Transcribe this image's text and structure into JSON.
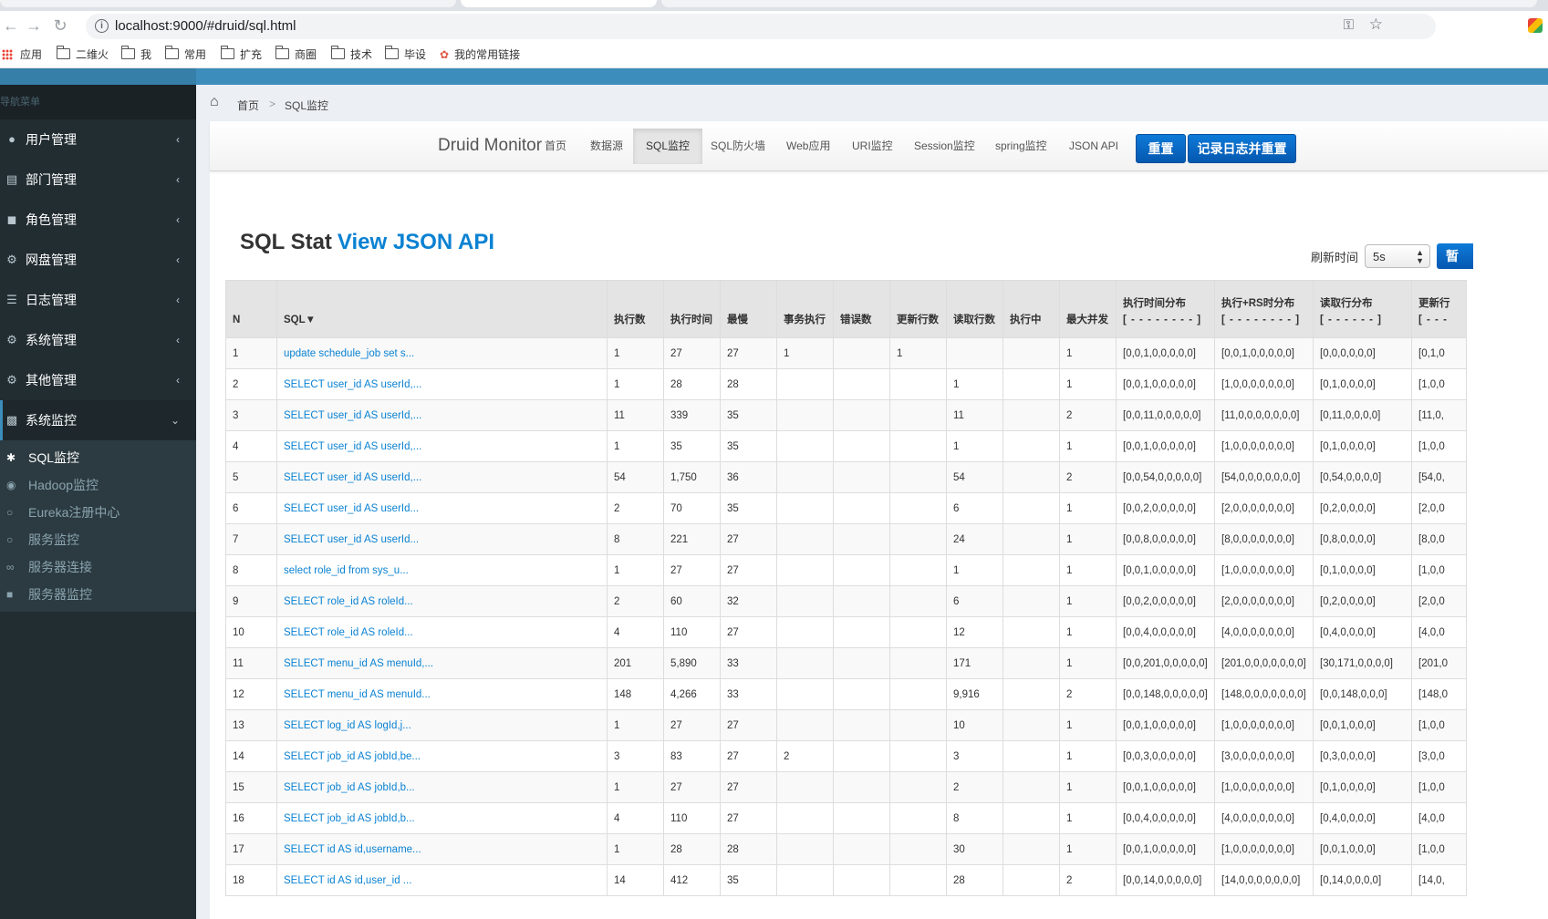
{
  "browser": {
    "url": "localhost:9000/#druid/sql.html",
    "bookmarks": [
      "应用",
      "二维火",
      "我",
      "常用",
      "扩充",
      "商圈",
      "技术",
      "毕设",
      "我的常用链接"
    ]
  },
  "sidebar": {
    "header": "导航菜单",
    "items": [
      {
        "label": "用户管理",
        "icon": "user-icon"
      },
      {
        "label": "部门管理",
        "icon": "id-card-icon"
      },
      {
        "label": "角色管理",
        "icon": "lock-icon"
      },
      {
        "label": "网盘管理",
        "icon": "gear-icon"
      },
      {
        "label": "日志管理",
        "icon": "file-icon"
      },
      {
        "label": "系统管理",
        "icon": "gear-icon"
      },
      {
        "label": "其他管理",
        "icon": "gear-icon"
      },
      {
        "label": "系统监控",
        "icon": "bar-chart-icon"
      }
    ],
    "subitems": [
      {
        "label": "SQL监控",
        "icon": "bug-icon"
      },
      {
        "label": "Hadoop监控",
        "icon": "eye-icon"
      },
      {
        "label": "Eureka注册中心",
        "icon": "circle-icon"
      },
      {
        "label": "服务监控",
        "icon": "circle-icon"
      },
      {
        "label": "服务器连接",
        "icon": "link-icon"
      },
      {
        "label": "服务器监控",
        "icon": "video-icon"
      }
    ]
  },
  "breadcrumb": {
    "home": "首页",
    "current": "SQL监控"
  },
  "druid_nav": {
    "brand": "Druid Monitor",
    "items": [
      "首页",
      "数据源",
      "SQL监控",
      "SQL防火墙",
      "Web应用",
      "URI监控",
      "Session监控",
      "spring监控",
      "JSON API"
    ],
    "active": "SQL监控",
    "reset_button": "重置",
    "log_reset_button": "记录日志并重置"
  },
  "page": {
    "title": "SQL Stat",
    "json_link": "View JSON API",
    "refresh_label": "刷新时间",
    "refresh_value": "5s",
    "pause_button": "暂"
  },
  "table": {
    "headers": [
      {
        "l1": "N"
      },
      {
        "l1": "SQL▼"
      },
      {
        "l1": "执行数"
      },
      {
        "l1": "执行时间"
      },
      {
        "l1": "最慢"
      },
      {
        "l1": "事务执行"
      },
      {
        "l1": "错误数"
      },
      {
        "l1": "更新行数"
      },
      {
        "l1": "读取行数"
      },
      {
        "l1": "执行中"
      },
      {
        "l1": "最大并发"
      },
      {
        "l1": "执行时间分布",
        "l2": "[ - - - - - - - - ]"
      },
      {
        "l1": "执行+RS时分布",
        "l2": "[ - - - - - - - - ]"
      },
      {
        "l1": "读取行分布",
        "l2": "[ - - - - - - ]"
      },
      {
        "l1": "更新行",
        "l2": "[ - - -"
      }
    ],
    "rows": [
      [
        "1",
        "update schedule_job set s...",
        "1",
        "27",
        "27",
        "1",
        "",
        "1",
        "",
        "",
        "1",
        "[0,0,1,0,0,0,0,0]",
        "[0,0,1,0,0,0,0,0]",
        "[0,0,0,0,0,0]",
        "[0,1,0"
      ],
      [
        "2",
        "SELECT user_id AS userId,...",
        "1",
        "28",
        "28",
        "",
        "",
        "",
        "1",
        "",
        "1",
        "[0,0,1,0,0,0,0,0]",
        "[1,0,0,0,0,0,0,0]",
        "[0,1,0,0,0,0]",
        "[1,0,0"
      ],
      [
        "3",
        "SELECT user_id AS userId,...",
        "11",
        "339",
        "35",
        "",
        "",
        "",
        "11",
        "",
        "2",
        "[0,0,11,0,0,0,0,0]",
        "[11,0,0,0,0,0,0,0]",
        "[0,11,0,0,0,0]",
        "[11,0,"
      ],
      [
        "4",
        "SELECT user_id AS userId,...",
        "1",
        "35",
        "35",
        "",
        "",
        "",
        "1",
        "",
        "1",
        "[0,0,1,0,0,0,0,0]",
        "[1,0,0,0,0,0,0,0]",
        "[0,1,0,0,0,0]",
        "[1,0,0"
      ],
      [
        "5",
        "SELECT user_id AS userId,...",
        "54",
        "1,750",
        "36",
        "",
        "",
        "",
        "54",
        "",
        "2",
        "[0,0,54,0,0,0,0,0]",
        "[54,0,0,0,0,0,0,0]",
        "[0,54,0,0,0,0]",
        "[54,0,"
      ],
      [
        "6",
        "SELECT user_id AS userId...",
        "2",
        "70",
        "35",
        "",
        "",
        "",
        "6",
        "",
        "1",
        "[0,0,2,0,0,0,0,0]",
        "[2,0,0,0,0,0,0,0]",
        "[0,2,0,0,0,0]",
        "[2,0,0"
      ],
      [
        "7",
        "SELECT user_id AS userId...",
        "8",
        "221",
        "27",
        "",
        "",
        "",
        "24",
        "",
        "1",
        "[0,0,8,0,0,0,0,0]",
        "[8,0,0,0,0,0,0,0]",
        "[0,8,0,0,0,0]",
        "[8,0,0"
      ],
      [
        "8",
        "select role_id from sys_u...",
        "1",
        "27",
        "27",
        "",
        "",
        "",
        "1",
        "",
        "1",
        "[0,0,1,0,0,0,0,0]",
        "[1,0,0,0,0,0,0,0]",
        "[0,1,0,0,0,0]",
        "[1,0,0"
      ],
      [
        "9",
        "SELECT role_id AS roleId...",
        "2",
        "60",
        "32",
        "",
        "",
        "",
        "6",
        "",
        "1",
        "[0,0,2,0,0,0,0,0]",
        "[2,0,0,0,0,0,0,0]",
        "[0,2,0,0,0,0]",
        "[2,0,0"
      ],
      [
        "10",
        "SELECT role_id AS roleId...",
        "4",
        "110",
        "27",
        "",
        "",
        "",
        "12",
        "",
        "1",
        "[0,0,4,0,0,0,0,0]",
        "[4,0,0,0,0,0,0,0]",
        "[0,4,0,0,0,0]",
        "[4,0,0"
      ],
      [
        "11",
        "SELECT menu_id AS menuId,...",
        "201",
        "5,890",
        "33",
        "",
        "",
        "",
        "171",
        "",
        "1",
        "[0,0,201,0,0,0,0,0]",
        "[201,0,0,0,0,0,0,0]",
        "[30,171,0,0,0,0]",
        "[201,0"
      ],
      [
        "12",
        "SELECT menu_id AS menuId...",
        "148",
        "4,266",
        "33",
        "",
        "",
        "",
        "9,916",
        "",
        "2",
        "[0,0,148,0,0,0,0,0]",
        "[148,0,0,0,0,0,0,0]",
        "[0,0,148,0,0,0]",
        "[148,0"
      ],
      [
        "13",
        "SELECT log_id AS logId,j...",
        "1",
        "27",
        "27",
        "",
        "",
        "",
        "10",
        "",
        "1",
        "[0,0,1,0,0,0,0,0]",
        "[1,0,0,0,0,0,0,0]",
        "[0,0,1,0,0,0]",
        "[1,0,0"
      ],
      [
        "14",
        "SELECT job_id AS jobId,be...",
        "3",
        "83",
        "27",
        "2",
        "",
        "",
        "3",
        "",
        "1",
        "[0,0,3,0,0,0,0,0]",
        "[3,0,0,0,0,0,0,0]",
        "[0,3,0,0,0,0]",
        "[3,0,0"
      ],
      [
        "15",
        "SELECT job_id AS jobId,b...",
        "1",
        "27",
        "27",
        "",
        "",
        "",
        "2",
        "",
        "1",
        "[0,0,1,0,0,0,0,0]",
        "[1,0,0,0,0,0,0,0]",
        "[0,1,0,0,0,0]",
        "[1,0,0"
      ],
      [
        "16",
        "SELECT job_id AS jobId,b...",
        "4",
        "110",
        "27",
        "",
        "",
        "",
        "8",
        "",
        "1",
        "[0,0,4,0,0,0,0,0]",
        "[4,0,0,0,0,0,0,0]",
        "[0,4,0,0,0,0]",
        "[4,0,0"
      ],
      [
        "17",
        "SELECT id AS id,username...",
        "1",
        "28",
        "28",
        "",
        "",
        "",
        "30",
        "",
        "1",
        "[0,0,1,0,0,0,0,0]",
        "[1,0,0,0,0,0,0,0]",
        "[0,0,1,0,0,0]",
        "[1,0,0"
      ],
      [
        "18",
        "SELECT id AS id,user_id ...",
        "14",
        "412",
        "35",
        "",
        "",
        "",
        "28",
        "",
        "2",
        "[0,0,14,0,0,0,0,0]",
        "[14,0,0,0,0,0,0,0]",
        "[0,14,0,0,0,0]",
        "[14,0,"
      ]
    ]
  }
}
